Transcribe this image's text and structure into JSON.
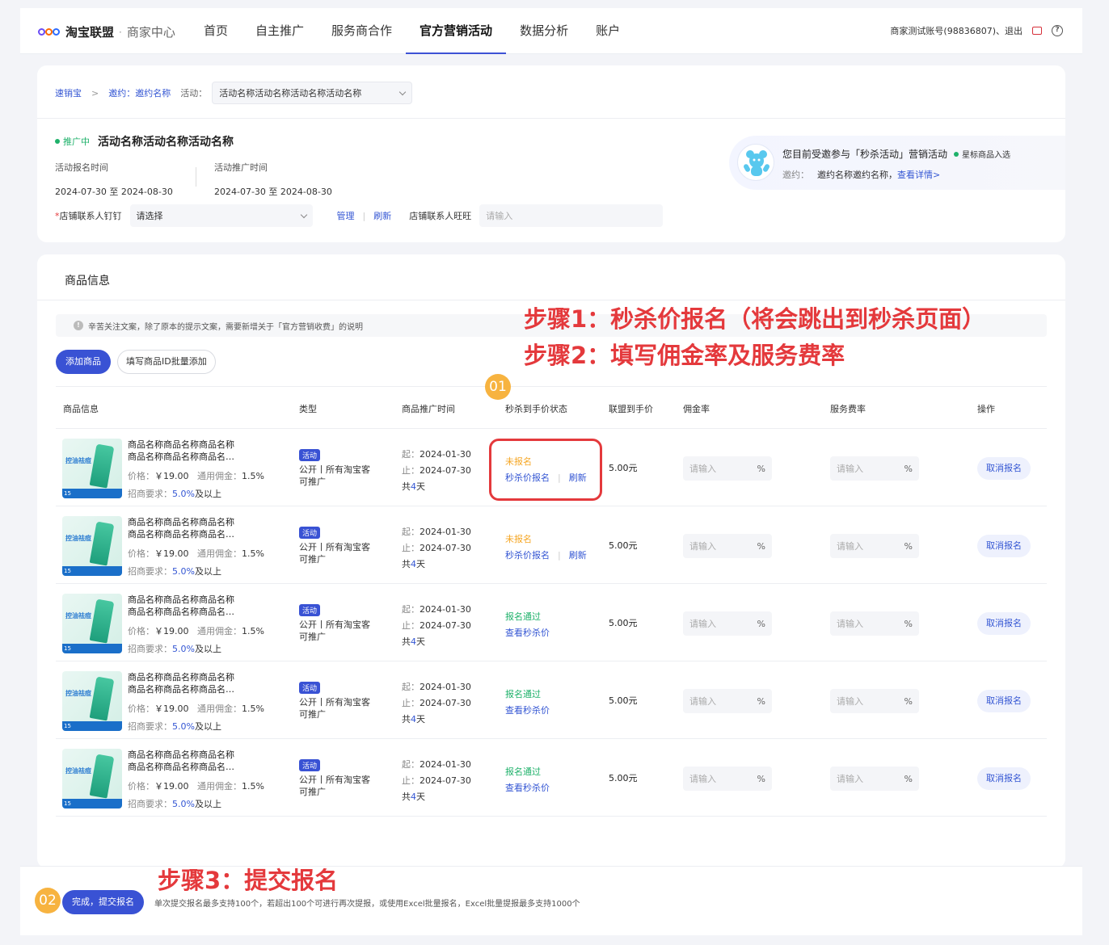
{
  "brand": {
    "name": "淘宝联盟",
    "sep": "·",
    "sub": "商家中心"
  },
  "nav": [
    "首页",
    "自主推广",
    "服务商合作",
    "官方营销活动",
    "数据分析",
    "账户"
  ],
  "nav_active_index": 3,
  "user": {
    "account": "商家测试账号(98836807)",
    "logout": "退出"
  },
  "breadcrumb": {
    "root": "速销宝",
    "invite": "邀约：邀约名称",
    "activity_label": "活动：",
    "activity_value": "活动名称活动名称活动名称活动名称"
  },
  "activity": {
    "status": "推广中",
    "title": "活动名称活动名称活动名称",
    "signup_time_label": "活动报名时间",
    "signup_time": "2024-07-30 至 2024-08-30",
    "promo_time_label": "活动推广时间",
    "promo_time": "2024-07-30 至 2024-08-30"
  },
  "contact": {
    "dingtalk_label": "店铺联系人钉钉",
    "dingtalk_placeholder": "请选择",
    "manage": "管理",
    "refresh": "刷新",
    "wangwang_label": "店铺联系人旺旺",
    "wangwang_placeholder": "请输入"
  },
  "invitation": {
    "title": "您目前受邀参与「秒杀活动」营销活动",
    "tag": "星标商品入选",
    "invite_label": "邀约：",
    "invite_name": "邀约名称邀约名称，",
    "detail": "查看详情>"
  },
  "products": {
    "section_title": "商品信息",
    "tip": "辛苦关注文案，除了原本的提示文案，需要新增关于「官方营销收费」的说明",
    "add_button": "添加商品",
    "batch_button": "填写商品ID批量添加",
    "columns": [
      "商品信息",
      "类型",
      "商品推广时间",
      "秒杀到手价状态",
      "联盟到手价",
      "佣金率",
      "服务费率",
      "操作"
    ],
    "rows": [
      {
        "name1": "商品名称商品名称商品名称",
        "name2": "商品名称商品名称商品名称商品名称",
        "price_label": "价格：",
        "price": "￥19.00",
        "comm_label": "通用佣金：",
        "comm": "1.5%",
        "req_label": "招商要求：",
        "req": "5.0%",
        "req_suffix": "及以上",
        "badge": "活动",
        "type1": "公开丨所有淘宝客",
        "type2": "可推广",
        "start_label": "起：",
        "start": "2024-01-30",
        "end_label": "止：",
        "end": "2024-07-30",
        "total_prefix": "共",
        "total": "4",
        "total_suffix": "天",
        "status": "未报名",
        "status_kind": "pending",
        "link1": "秒杀价报名",
        "link2": "刷新",
        "union_price": "5.00元",
        "comm_placeholder": "请输入",
        "fee_placeholder": "请输入",
        "pct": "%",
        "action": "取消报名"
      },
      {
        "name1": "商品名称商品名称商品名称",
        "name2": "商品名称商品名称商品名称商品名称",
        "price_label": "价格：",
        "price": "￥19.00",
        "comm_label": "通用佣金：",
        "comm": "1.5%",
        "req_label": "招商要求：",
        "req": "5.0%",
        "req_suffix": "及以上",
        "badge": "活动",
        "type1": "公开丨所有淘宝客",
        "type2": "可推广",
        "start_label": "起：",
        "start": "2024-01-30",
        "end_label": "止：",
        "end": "2024-07-30",
        "total_prefix": "共",
        "total": "4",
        "total_suffix": "天",
        "status": "未报名",
        "status_kind": "pending",
        "link1": "秒杀价报名",
        "link2": "刷新",
        "union_price": "5.00元",
        "comm_placeholder": "请输入",
        "fee_placeholder": "请输入",
        "pct": "%",
        "action": "取消报名"
      },
      {
        "name1": "商品名称商品名称商品名称",
        "name2": "商品名称商品名称商品名称商品名称",
        "price_label": "价格：",
        "price": "￥19.00",
        "comm_label": "通用佣金：",
        "comm": "1.5%",
        "req_label": "招商要求：",
        "req": "5.0%",
        "req_suffix": "及以上",
        "badge": "活动",
        "type1": "公开丨所有淘宝客",
        "type2": "可推广",
        "start_label": "起：",
        "start": "2024-01-30",
        "end_label": "止：",
        "end": "2024-07-30",
        "total_prefix": "共",
        "total": "4",
        "total_suffix": "天",
        "status": "报名通过",
        "status_kind": "passed",
        "link1": "查看秒杀价",
        "link2": "",
        "union_price": "5.00元",
        "comm_placeholder": "请输入",
        "fee_placeholder": "请输入",
        "pct": "%",
        "action": "取消报名"
      },
      {
        "name1": "商品名称商品名称商品名称",
        "name2": "商品名称商品名称商品名称商品名称",
        "price_label": "价格：",
        "price": "￥19.00",
        "comm_label": "通用佣金：",
        "comm": "1.5%",
        "req_label": "招商要求：",
        "req": "5.0%",
        "req_suffix": "及以上",
        "badge": "活动",
        "type1": "公开丨所有淘宝客",
        "type2": "可推广",
        "start_label": "起：",
        "start": "2024-01-30",
        "end_label": "止：",
        "end": "2024-07-30",
        "total_prefix": "共",
        "total": "4",
        "total_suffix": "天",
        "status": "报名通过",
        "status_kind": "passed",
        "link1": "查看秒杀价",
        "link2": "",
        "union_price": "5.00元",
        "comm_placeholder": "请输入",
        "fee_placeholder": "请输入",
        "pct": "%",
        "action": "取消报名"
      },
      {
        "name1": "商品名称商品名称商品名称",
        "name2": "商品名称商品名称商品名称商品名称",
        "price_label": "价格：",
        "price": "￥19.00",
        "comm_label": "通用佣金：",
        "comm": "1.5%",
        "req_label": "招商要求：",
        "req": "5.0%",
        "req_suffix": "及以上",
        "badge": "活动",
        "type1": "公开丨所有淘宝客",
        "type2": "可推广",
        "start_label": "起：",
        "start": "2024-01-30",
        "end_label": "止：",
        "end": "2024-07-30",
        "total_prefix": "共",
        "total": "4",
        "total_suffix": "天",
        "status": "报名通过",
        "status_kind": "passed",
        "link1": "查看秒杀价",
        "link2": "",
        "union_price": "5.00元",
        "comm_placeholder": "请输入",
        "fee_placeholder": "请输入",
        "pct": "%",
        "action": "取消报名"
      }
    ]
  },
  "thumb": {
    "title": "控油祛痘",
    "band": "15"
  },
  "footer": {
    "submit": "完成，提交报名",
    "note": "单次提交报名最多支持100个，若超出100个可进行再次提报，或使用Excel批量报名，Excel批量提报最多支持1000个"
  },
  "annotations": {
    "step1": "步骤1：秒杀价报名（将会跳出到秒杀页面）",
    "step2": "步骤2：填写佣金率及服务费率",
    "step3": "步骤3：提交报名",
    "marker1": "01",
    "marker2": "02"
  },
  "colors": {
    "primary": "#3952d4",
    "link": "#3456d3",
    "green": "#1eb16a",
    "orange": "#f5a623",
    "red": "#e4393c",
    "marker": "#f7b340"
  }
}
